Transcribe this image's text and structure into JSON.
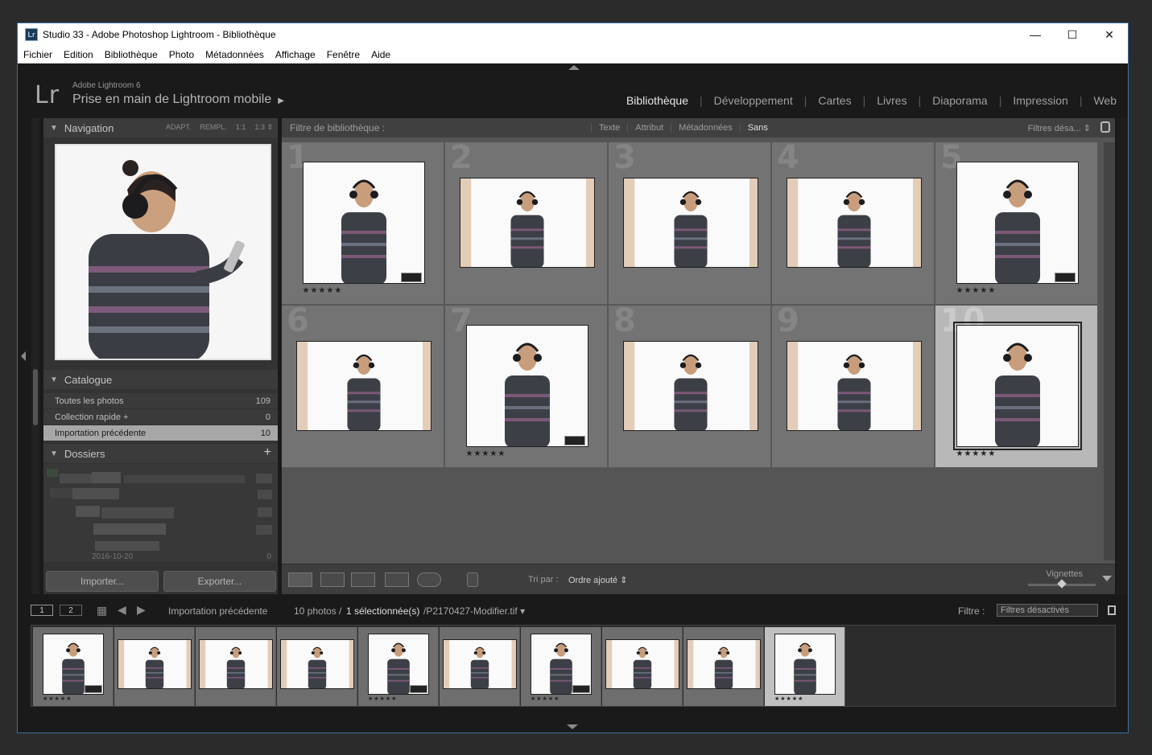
{
  "window": {
    "title": "Studio 33 - Adobe Photoshop Lightroom - Bibliothèque",
    "app_icon": "Lr",
    "controls": [
      "—",
      "☐",
      "✕"
    ]
  },
  "menu": [
    "Fichier",
    "Edition",
    "Bibliothèque",
    "Photo",
    "Métadonnées",
    "Affichage",
    "Fenêtre",
    "Aide"
  ],
  "identity": {
    "logo": "Lr",
    "product": "Adobe Lightroom 6",
    "task": "Prise en main de Lightroom mobile",
    "task_arrow": "▶"
  },
  "modules": [
    {
      "label": "Bibliothèque",
      "active": true
    },
    {
      "label": "Développement",
      "active": false
    },
    {
      "label": "Cartes",
      "active": false
    },
    {
      "label": "Livres",
      "active": false
    },
    {
      "label": "Diaporama",
      "active": false
    },
    {
      "label": "Impression",
      "active": false
    },
    {
      "label": "Web",
      "active": false
    }
  ],
  "navigator": {
    "title": "Navigation",
    "options": [
      "ADAPT.",
      "REMPL.",
      "1:1",
      "1:3 ⇕"
    ]
  },
  "catalog": {
    "title": "Catalogue",
    "items": [
      {
        "label": "Toutes les photos",
        "count": "109",
        "selected": false
      },
      {
        "label": "Collection rapide +",
        "count": "0",
        "selected": false
      },
      {
        "label": "Importation précédente",
        "count": "10",
        "selected": true
      }
    ]
  },
  "folders": {
    "title": "Dossiers",
    "add": "+",
    "partial_label": "2016-10-20",
    "partial_count": "0"
  },
  "buttons": {
    "import": "Importer...",
    "export": "Exporter..."
  },
  "filter_bar": {
    "title": "Filtre de bibliothèque :",
    "options": [
      {
        "label": "Texte",
        "active": false
      },
      {
        "label": "Attribut",
        "active": false
      },
      {
        "label": "Métadonnées",
        "active": false
      },
      {
        "label": "Sans",
        "active": true
      }
    ],
    "preset": "Filtres désa... ⇕"
  },
  "grid": {
    "cells": [
      {
        "num": "1",
        "orientation": "portrait",
        "stars": "★★★★★",
        "badge": true,
        "selected": false
      },
      {
        "num": "2",
        "orientation": "landscape",
        "stars": "",
        "badge": false,
        "selected": false
      },
      {
        "num": "3",
        "orientation": "landscape",
        "stars": "",
        "badge": false,
        "selected": false
      },
      {
        "num": "4",
        "orientation": "landscape",
        "stars": "",
        "badge": false,
        "selected": false
      },
      {
        "num": "5",
        "orientation": "portrait",
        "stars": "★★★★★",
        "badge": true,
        "selected": false
      },
      {
        "num": "6",
        "orientation": "landscape",
        "stars": "",
        "badge": false,
        "selected": false
      },
      {
        "num": "7",
        "orientation": "portrait",
        "stars": "★★★★★",
        "badge": true,
        "selected": false
      },
      {
        "num": "8",
        "orientation": "landscape",
        "stars": "",
        "badge": false,
        "selected": false
      },
      {
        "num": "9",
        "orientation": "landscape",
        "stars": "",
        "badge": false,
        "selected": false
      },
      {
        "num": "10",
        "orientation": "portrait",
        "stars": "★★★★★",
        "badge": false,
        "selected": true
      }
    ]
  },
  "toolbar": {
    "sort_label": "Tri par :",
    "sort_value": "Ordre ajouté ⇕",
    "thumb_label": "Vignettes",
    "thumb_size": 0.5
  },
  "filmstrip_bar": {
    "screen1": "1",
    "screen2": "2",
    "source": "Importation précédente",
    "count_text": "10 photos /",
    "selected_text": "1 sélectionnée(s)",
    "file_text": "/P2170427-Modifier.tif ▾",
    "filter_label": "Filtre :",
    "filter_value": "Filtres désactivés"
  },
  "filmstrip": {
    "cells": [
      {
        "orientation": "portrait",
        "stars": "★★★★★",
        "badge": true,
        "selected": false
      },
      {
        "orientation": "landscape",
        "stars": "",
        "badge": false,
        "selected": false
      },
      {
        "orientation": "landscape",
        "stars": "",
        "badge": false,
        "selected": false
      },
      {
        "orientation": "landscape",
        "stars": "",
        "badge": false,
        "selected": false
      },
      {
        "orientation": "portrait",
        "stars": "★★★★★",
        "badge": true,
        "selected": false
      },
      {
        "orientation": "landscape",
        "stars": "",
        "badge": false,
        "selected": false
      },
      {
        "orientation": "portrait",
        "stars": "★★★★★",
        "badge": true,
        "selected": false
      },
      {
        "orientation": "landscape",
        "stars": "",
        "badge": false,
        "selected": false
      },
      {
        "orientation": "landscape",
        "stars": "",
        "badge": false,
        "selected": false
      },
      {
        "orientation": "portrait",
        "stars": "★★★★★",
        "badge": false,
        "selected": true
      }
    ]
  },
  "colors": {
    "accent_border": "#3a6ea5",
    "selected_cell": "#b8b8b8",
    "cell": "#737373"
  }
}
